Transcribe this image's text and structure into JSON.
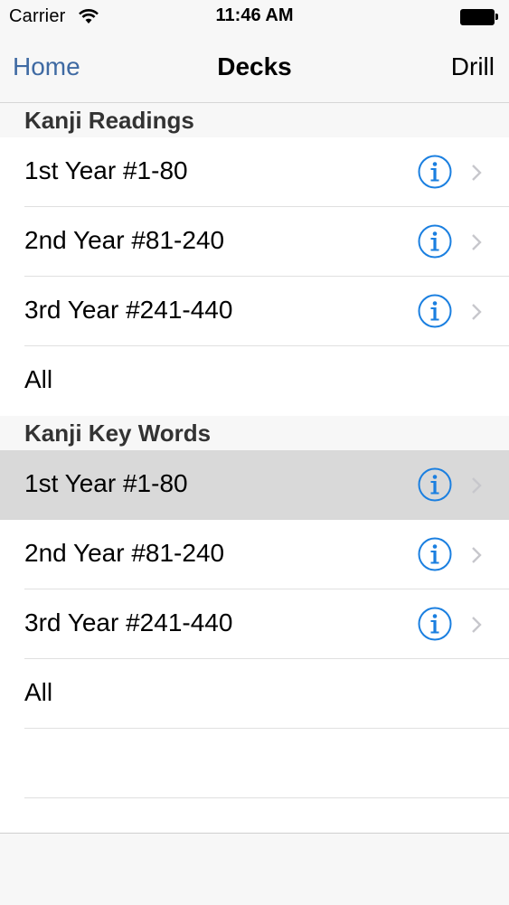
{
  "status_bar": {
    "carrier": "Carrier",
    "time": "11:46 AM"
  },
  "nav": {
    "back_label": "Home",
    "title": "Decks",
    "right_label": "Drill"
  },
  "colors": {
    "accent": "#3f6aa3",
    "info_blue": "#1a7fe0",
    "chevron": "#c7c7cc",
    "highlight": "#d9d9d9"
  },
  "sections": [
    {
      "header": "Kanji Readings",
      "rows": [
        {
          "label": "1st Year #1-80",
          "has_info": true
        },
        {
          "label": "2nd Year #81-240",
          "has_info": true
        },
        {
          "label": "3rd Year #241-440",
          "has_info": true
        },
        {
          "label": "All",
          "has_info": false
        }
      ]
    },
    {
      "header": "Kanji Key Words",
      "rows": [
        {
          "label": "1st Year #1-80",
          "has_info": true,
          "selected": true
        },
        {
          "label": "2nd Year #81-240",
          "has_info": true
        },
        {
          "label": "3rd Year #241-440",
          "has_info": true
        },
        {
          "label": "All",
          "has_info": false
        }
      ]
    }
  ]
}
